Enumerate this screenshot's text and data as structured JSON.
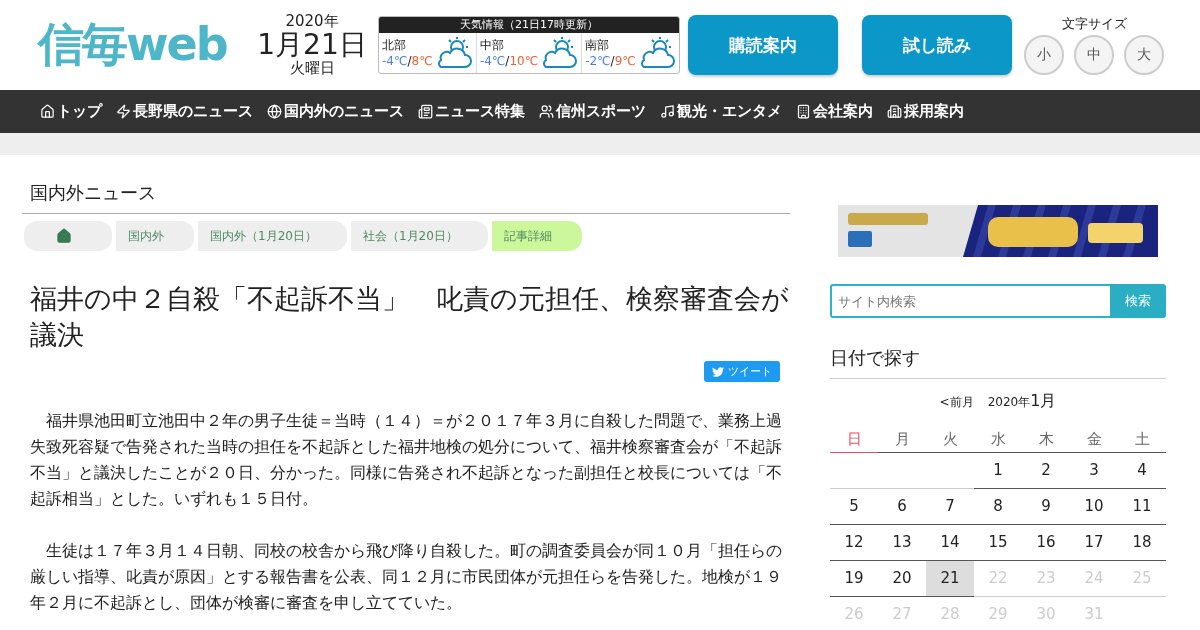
{
  "header": {
    "logo": "信毎web",
    "date": {
      "year": "2020年",
      "day": "1月21日",
      "weekday": "火曜日"
    },
    "weather": {
      "title": "天気情報（21日17時更新）",
      "regions": [
        {
          "name": "北部",
          "low": "-4℃",
          "separator": "/",
          "high": "8℃"
        },
        {
          "name": "中部",
          "low": "-4℃",
          "separator": "/",
          "high": "10℃"
        },
        {
          "name": "南部",
          "low": "-2℃",
          "separator": "/",
          "high": "9℃"
        }
      ]
    },
    "buttons": [
      "購読案内",
      "試し読み"
    ],
    "font_size": {
      "label": "文字サイズ",
      "options": [
        "小",
        "中",
        "大"
      ]
    }
  },
  "nav": [
    {
      "label": "トップ",
      "kind": "home"
    },
    {
      "label": "長野県のニュース",
      "kind": "nagano"
    },
    {
      "label": "国内外のニュース",
      "kind": "globe"
    },
    {
      "label": "ニュース特集",
      "kind": "feature"
    },
    {
      "label": "信州スポーツ",
      "kind": "sports"
    },
    {
      "label": "観光・エンタメ",
      "kind": "tourism"
    },
    {
      "label": "会社案内",
      "kind": "company"
    },
    {
      "label": "採用案内",
      "kind": "recruit"
    }
  ],
  "section_title": "国内外ニュース",
  "breadcrumb": [
    {
      "kind": "home",
      "selected": false
    },
    {
      "label": "国内外",
      "selected": false
    },
    {
      "label": "国内外（1月20日）",
      "selected": false
    },
    {
      "label": "社会（1月20日）",
      "selected": false
    },
    {
      "label": "記事詳細",
      "selected": true
    }
  ],
  "article": {
    "title": "福井の中２自殺「不起訴不当」　叱責の元担任、検察審査会が議決",
    "tweet": "ツイート",
    "paragraphs": [
      "　福井県池田町立池田中２年の男子生徒＝当時（１４）＝が２０１７年３月に自殺した問題で、業務上過失致死容疑で告発された当時の担任を不起訴とした福井地検の処分について、福井検察審査会が「不起訴不当」と議決したことが２０日、分かった。同様に告発され不起訴となった副担任と校長については「不起訴相当」とした。いずれも１５日付。",
      "　生徒は１７年３月１４日朝、同校の校舎から飛び降り自殺した。町の調査委員会が同１０月「担任らの厳しい指導、叱責が原因」とする報告書を公表、同１２月に市民団体が元担任らを告発した。地検が１９年２月に不起訴とし、団体が検審に審査を申し立てていた。"
    ]
  },
  "sidebar": {
    "search": {
      "placeholder": "サイト内検索",
      "button": "検索"
    },
    "calendar": {
      "title": "日付で探す",
      "prev": "<前月",
      "year": "2020年",
      "month": "1月",
      "weekdays": [
        {
          "label": "日",
          "kind": "sunday"
        },
        {
          "label": "月",
          "kind": "weekday"
        },
        {
          "label": "火",
          "kind": "weekday"
        },
        {
          "label": "水",
          "kind": "weekday"
        },
        {
          "label": "木",
          "kind": "weekday"
        },
        {
          "label": "金",
          "kind": "weekday"
        },
        {
          "label": "土",
          "kind": "weekday"
        }
      ],
      "weeks": [
        [
          {
            "kind": "blank"
          },
          {
            "kind": "blank"
          },
          {
            "kind": "blank"
          },
          {
            "kind": "day",
            "label": "1",
            "selected": false,
            "disabled": false
          },
          {
            "kind": "day",
            "label": "2",
            "selected": false,
            "disabled": false
          },
          {
            "kind": "day",
            "label": "3",
            "selected": false,
            "disabled": false
          },
          {
            "kind": "day",
            "label": "4",
            "selected": false,
            "disabled": false
          }
        ],
        [
          {
            "kind": "day",
            "label": "5",
            "selected": false,
            "disabled": false
          },
          {
            "kind": "day",
            "label": "6",
            "selected": false,
            "disabled": false
          },
          {
            "kind": "day",
            "label": "7",
            "selected": false,
            "disabled": false
          },
          {
            "kind": "day",
            "label": "8",
            "selected": false,
            "disabled": false
          },
          {
            "kind": "day",
            "label": "9",
            "selected": false,
            "disabled": false
          },
          {
            "kind": "day",
            "label": "10",
            "selected": false,
            "disabled": false
          },
          {
            "kind": "day",
            "label": "11",
            "selected": false,
            "disabled": false
          }
        ],
        [
          {
            "kind": "day",
            "label": "12",
            "selected": false,
            "disabled": false
          },
          {
            "kind": "day",
            "label": "13",
            "selected": false,
            "disabled": false
          },
          {
            "kind": "day",
            "label": "14",
            "selected": false,
            "disabled": false
          },
          {
            "kind": "day",
            "label": "15",
            "selected": false,
            "disabled": false
          },
          {
            "kind": "day",
            "label": "16",
            "selected": false,
            "disabled": false
          },
          {
            "kind": "day",
            "label": "17",
            "selected": false,
            "disabled": false
          },
          {
            "kind": "day",
            "label": "18",
            "selected": false,
            "disabled": false
          }
        ],
        [
          {
            "kind": "day",
            "label": "19",
            "selected": false,
            "disabled": false
          },
          {
            "kind": "day",
            "label": "20",
            "selected": false,
            "disabled": false
          },
          {
            "kind": "day",
            "label": "21",
            "selected": true,
            "disabled": false
          },
          {
            "kind": "day",
            "label": "22",
            "selected": false,
            "disabled": true
          },
          {
            "kind": "day",
            "label": "23",
            "selected": false,
            "disabled": true
          },
          {
            "kind": "day",
            "label": "24",
            "selected": false,
            "disabled": true
          },
          {
            "kind": "day",
            "label": "25",
            "selected": false,
            "disabled": true
          }
        ],
        [
          {
            "kind": "day",
            "label": "26",
            "selected": false,
            "disabled": true
          },
          {
            "kind": "day",
            "label": "27",
            "selected": false,
            "disabled": true
          },
          {
            "kind": "day",
            "label": "28",
            "selected": false,
            "disabled": true
          },
          {
            "kind": "day",
            "label": "29",
            "selected": false,
            "disabled": true
          },
          {
            "kind": "day",
            "label": "30",
            "selected": false,
            "disabled": true
          },
          {
            "kind": "day",
            "label": "31",
            "selected": false,
            "disabled": true
          },
          {
            "kind": "blank"
          }
        ]
      ]
    }
  }
}
